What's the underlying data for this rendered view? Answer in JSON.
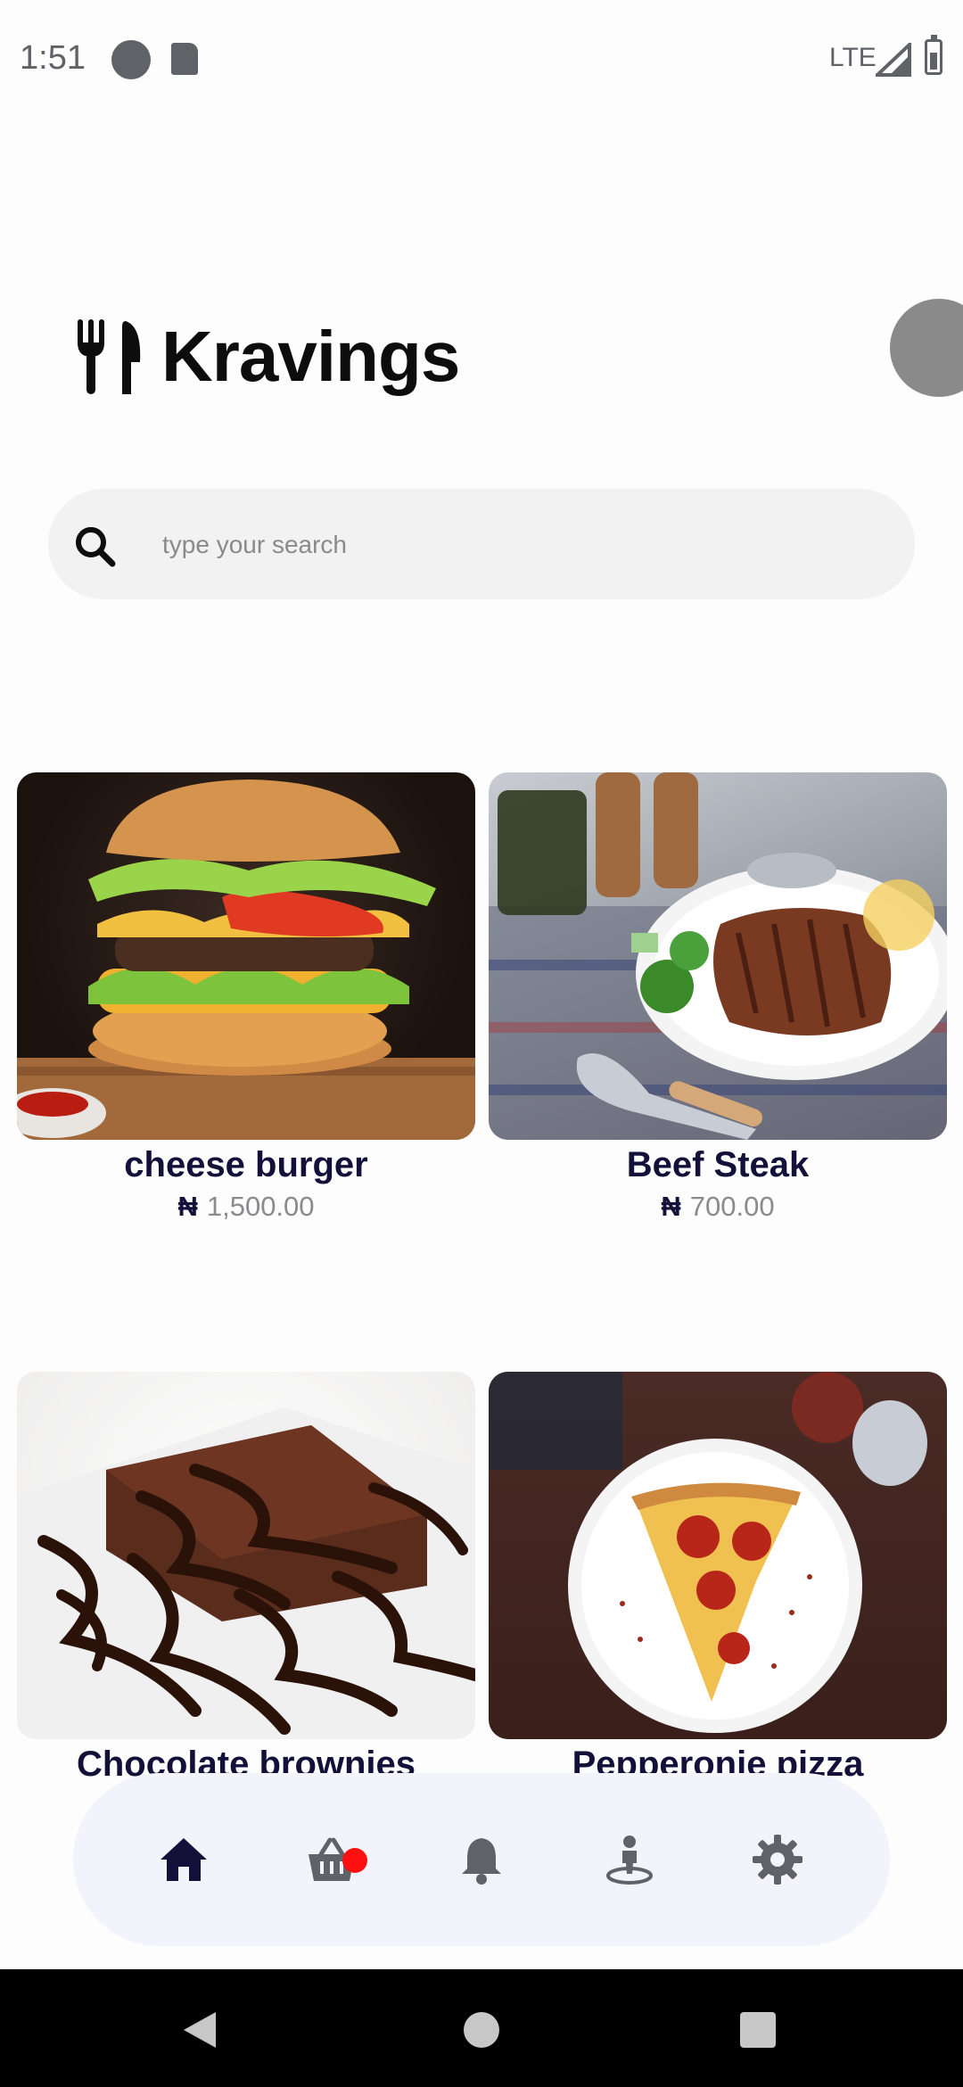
{
  "status_bar": {
    "time": "1:51",
    "network": "LTE",
    "icons": [
      "app-a-icon",
      "sd-card-icon",
      "signal-icon",
      "battery-icon"
    ]
  },
  "header": {
    "title": "Kravings",
    "logo_icon": "utensils-icon"
  },
  "search": {
    "placeholder": "type your search",
    "value": ""
  },
  "products": [
    {
      "name": "cheese burger",
      "currency": "₦",
      "price": "1,500.00",
      "image": "cheese-burger-photo"
    },
    {
      "name": "Beef Steak",
      "currency": "₦",
      "price": "700.00",
      "image": "beef-steak-photo"
    },
    {
      "name": "Chocolate brownies",
      "image": "chocolate-brownies-photo"
    },
    {
      "name": "Pepperonie pizza",
      "image": "pepperoni-pizza-photo"
    }
  ],
  "bottom_nav": {
    "items": [
      {
        "icon": "home-icon",
        "active": true
      },
      {
        "icon": "basket-icon",
        "badge": true
      },
      {
        "icon": "bell-icon"
      },
      {
        "icon": "map-pin-person-icon"
      },
      {
        "icon": "gear-icon"
      }
    ]
  },
  "colors": {
    "active_icon": "#13103a",
    "inactive_icon": "#5f6368",
    "badge": "#ff1010",
    "title": "#0d0d0d"
  }
}
